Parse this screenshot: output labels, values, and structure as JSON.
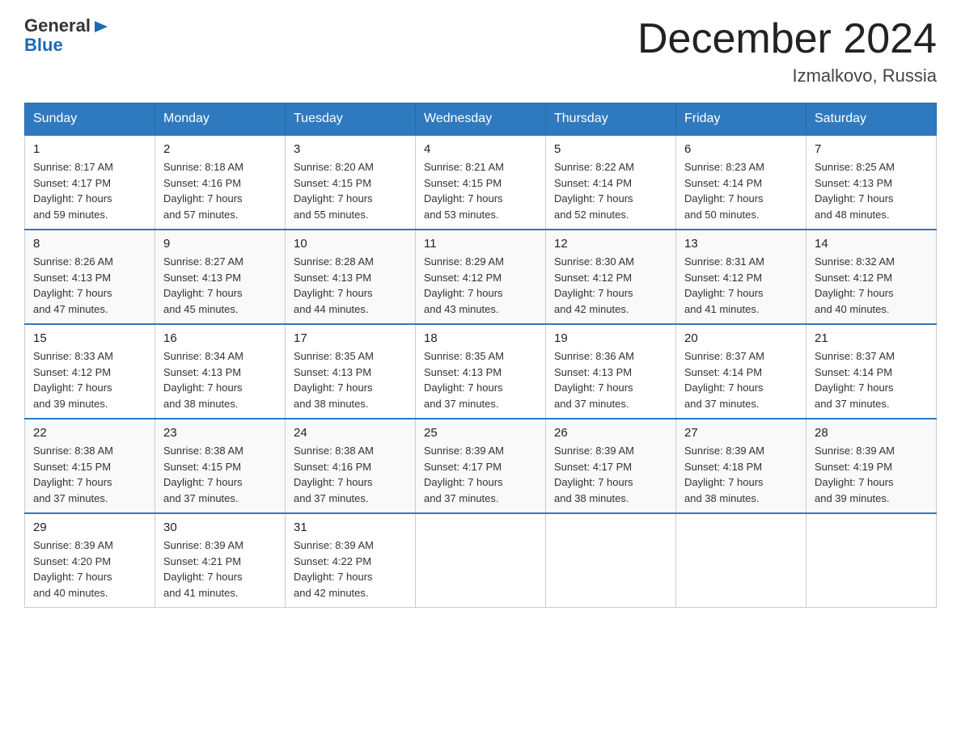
{
  "header": {
    "logo_general": "General",
    "logo_blue": "Blue",
    "month_title": "December 2024",
    "location": "Izmalkovo, Russia"
  },
  "weekdays": [
    "Sunday",
    "Monday",
    "Tuesday",
    "Wednesday",
    "Thursday",
    "Friday",
    "Saturday"
  ],
  "weeks": [
    [
      {
        "day": "1",
        "sunrise": "8:17 AM",
        "sunset": "4:17 PM",
        "daylight": "7 hours and 59 minutes."
      },
      {
        "day": "2",
        "sunrise": "8:18 AM",
        "sunset": "4:16 PM",
        "daylight": "7 hours and 57 minutes."
      },
      {
        "day": "3",
        "sunrise": "8:20 AM",
        "sunset": "4:15 PM",
        "daylight": "7 hours and 55 minutes."
      },
      {
        "day": "4",
        "sunrise": "8:21 AM",
        "sunset": "4:15 PM",
        "daylight": "7 hours and 53 minutes."
      },
      {
        "day": "5",
        "sunrise": "8:22 AM",
        "sunset": "4:14 PM",
        "daylight": "7 hours and 52 minutes."
      },
      {
        "day": "6",
        "sunrise": "8:23 AM",
        "sunset": "4:14 PM",
        "daylight": "7 hours and 50 minutes."
      },
      {
        "day": "7",
        "sunrise": "8:25 AM",
        "sunset": "4:13 PM",
        "daylight": "7 hours and 48 minutes."
      }
    ],
    [
      {
        "day": "8",
        "sunrise": "8:26 AM",
        "sunset": "4:13 PM",
        "daylight": "7 hours and 47 minutes."
      },
      {
        "day": "9",
        "sunrise": "8:27 AM",
        "sunset": "4:13 PM",
        "daylight": "7 hours and 45 minutes."
      },
      {
        "day": "10",
        "sunrise": "8:28 AM",
        "sunset": "4:13 PM",
        "daylight": "7 hours and 44 minutes."
      },
      {
        "day": "11",
        "sunrise": "8:29 AM",
        "sunset": "4:12 PM",
        "daylight": "7 hours and 43 minutes."
      },
      {
        "day": "12",
        "sunrise": "8:30 AM",
        "sunset": "4:12 PM",
        "daylight": "7 hours and 42 minutes."
      },
      {
        "day": "13",
        "sunrise": "8:31 AM",
        "sunset": "4:12 PM",
        "daylight": "7 hours and 41 minutes."
      },
      {
        "day": "14",
        "sunrise": "8:32 AM",
        "sunset": "4:12 PM",
        "daylight": "7 hours and 40 minutes."
      }
    ],
    [
      {
        "day": "15",
        "sunrise": "8:33 AM",
        "sunset": "4:12 PM",
        "daylight": "7 hours and 39 minutes."
      },
      {
        "day": "16",
        "sunrise": "8:34 AM",
        "sunset": "4:13 PM",
        "daylight": "7 hours and 38 minutes."
      },
      {
        "day": "17",
        "sunrise": "8:35 AM",
        "sunset": "4:13 PM",
        "daylight": "7 hours and 38 minutes."
      },
      {
        "day": "18",
        "sunrise": "8:35 AM",
        "sunset": "4:13 PM",
        "daylight": "7 hours and 37 minutes."
      },
      {
        "day": "19",
        "sunrise": "8:36 AM",
        "sunset": "4:13 PM",
        "daylight": "7 hours and 37 minutes."
      },
      {
        "day": "20",
        "sunrise": "8:37 AM",
        "sunset": "4:14 PM",
        "daylight": "7 hours and 37 minutes."
      },
      {
        "day": "21",
        "sunrise": "8:37 AM",
        "sunset": "4:14 PM",
        "daylight": "7 hours and 37 minutes."
      }
    ],
    [
      {
        "day": "22",
        "sunrise": "8:38 AM",
        "sunset": "4:15 PM",
        "daylight": "7 hours and 37 minutes."
      },
      {
        "day": "23",
        "sunrise": "8:38 AM",
        "sunset": "4:15 PM",
        "daylight": "7 hours and 37 minutes."
      },
      {
        "day": "24",
        "sunrise": "8:38 AM",
        "sunset": "4:16 PM",
        "daylight": "7 hours and 37 minutes."
      },
      {
        "day": "25",
        "sunrise": "8:39 AM",
        "sunset": "4:17 PM",
        "daylight": "7 hours and 37 minutes."
      },
      {
        "day": "26",
        "sunrise": "8:39 AM",
        "sunset": "4:17 PM",
        "daylight": "7 hours and 38 minutes."
      },
      {
        "day": "27",
        "sunrise": "8:39 AM",
        "sunset": "4:18 PM",
        "daylight": "7 hours and 38 minutes."
      },
      {
        "day": "28",
        "sunrise": "8:39 AM",
        "sunset": "4:19 PM",
        "daylight": "7 hours and 39 minutes."
      }
    ],
    [
      {
        "day": "29",
        "sunrise": "8:39 AM",
        "sunset": "4:20 PM",
        "daylight": "7 hours and 40 minutes."
      },
      {
        "day": "30",
        "sunrise": "8:39 AM",
        "sunset": "4:21 PM",
        "daylight": "7 hours and 41 minutes."
      },
      {
        "day": "31",
        "sunrise": "8:39 AM",
        "sunset": "4:22 PM",
        "daylight": "7 hours and 42 minutes."
      },
      null,
      null,
      null,
      null
    ]
  ],
  "labels": {
    "sunrise": "Sunrise:",
    "sunset": "Sunset:",
    "daylight": "Daylight:"
  }
}
